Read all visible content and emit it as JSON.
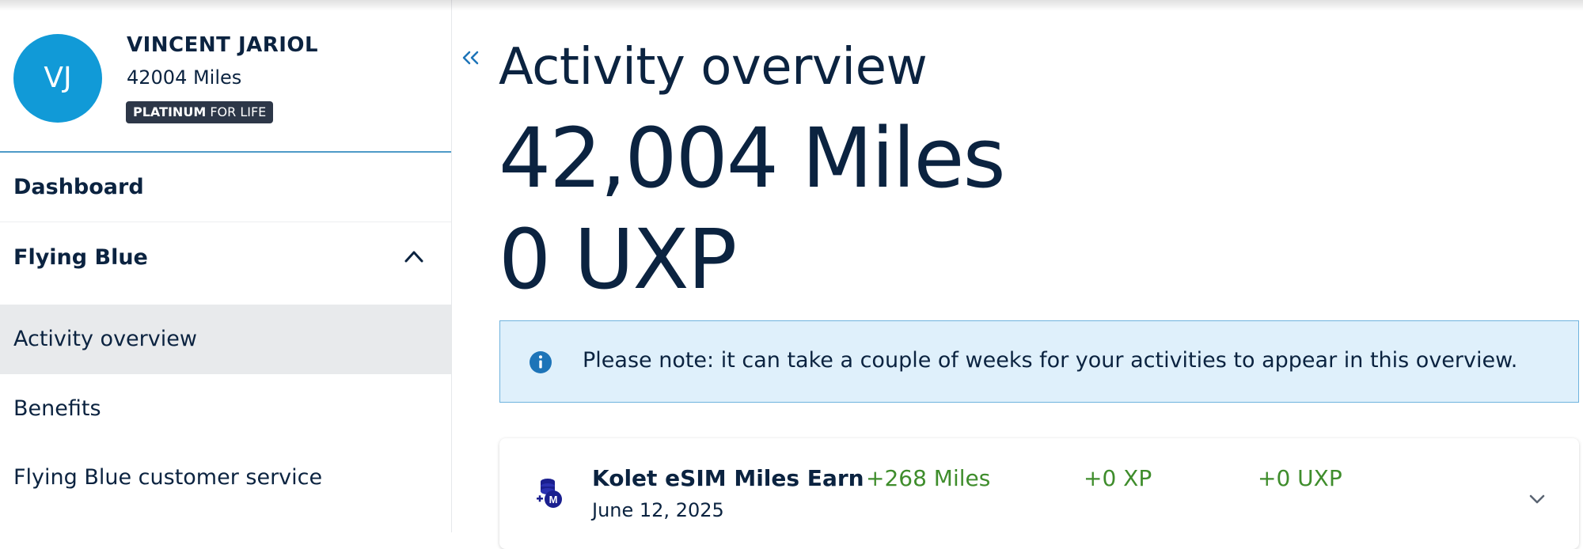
{
  "profile": {
    "initials": "VJ",
    "name": "VINCENT JARIOL",
    "miles": "42004 Miles",
    "badge_strong": "PLATINUM",
    "badge_rest": " FOR LIFE",
    "avatar_color": "#119ad7"
  },
  "sidebar": {
    "items": [
      {
        "label": "Dashboard"
      },
      {
        "label": "Flying Blue",
        "icon": "chevron-up-icon"
      },
      {
        "label": "Activity overview",
        "selected": true
      },
      {
        "label": "Benefits"
      },
      {
        "label": "Flying Blue customer service"
      }
    ]
  },
  "main": {
    "collapse_icon": "double-chevron-left-icon",
    "title": "Activity overview",
    "miles_total": "42,004 Miles",
    "uxp_total": "0 UXP",
    "notice": {
      "icon": "info-icon",
      "text": "Please note: it can take a couple of weeks for your activities to appear in this overview."
    },
    "activities": [
      {
        "icon": "miles-coin-icon",
        "title": "Kolet eSIM Miles Earn",
        "date": "June 12, 2025",
        "miles": "+268 Miles",
        "xp": "+0 XP",
        "uxp": "+0 UXP",
        "expand_icon": "chevron-down-icon"
      }
    ]
  },
  "colors": {
    "accent": "#119ad7",
    "text": "#0b2340",
    "positive": "#3f8d2c",
    "notice_bg": "#dff0fb",
    "notice_border": "#6fb3de"
  }
}
